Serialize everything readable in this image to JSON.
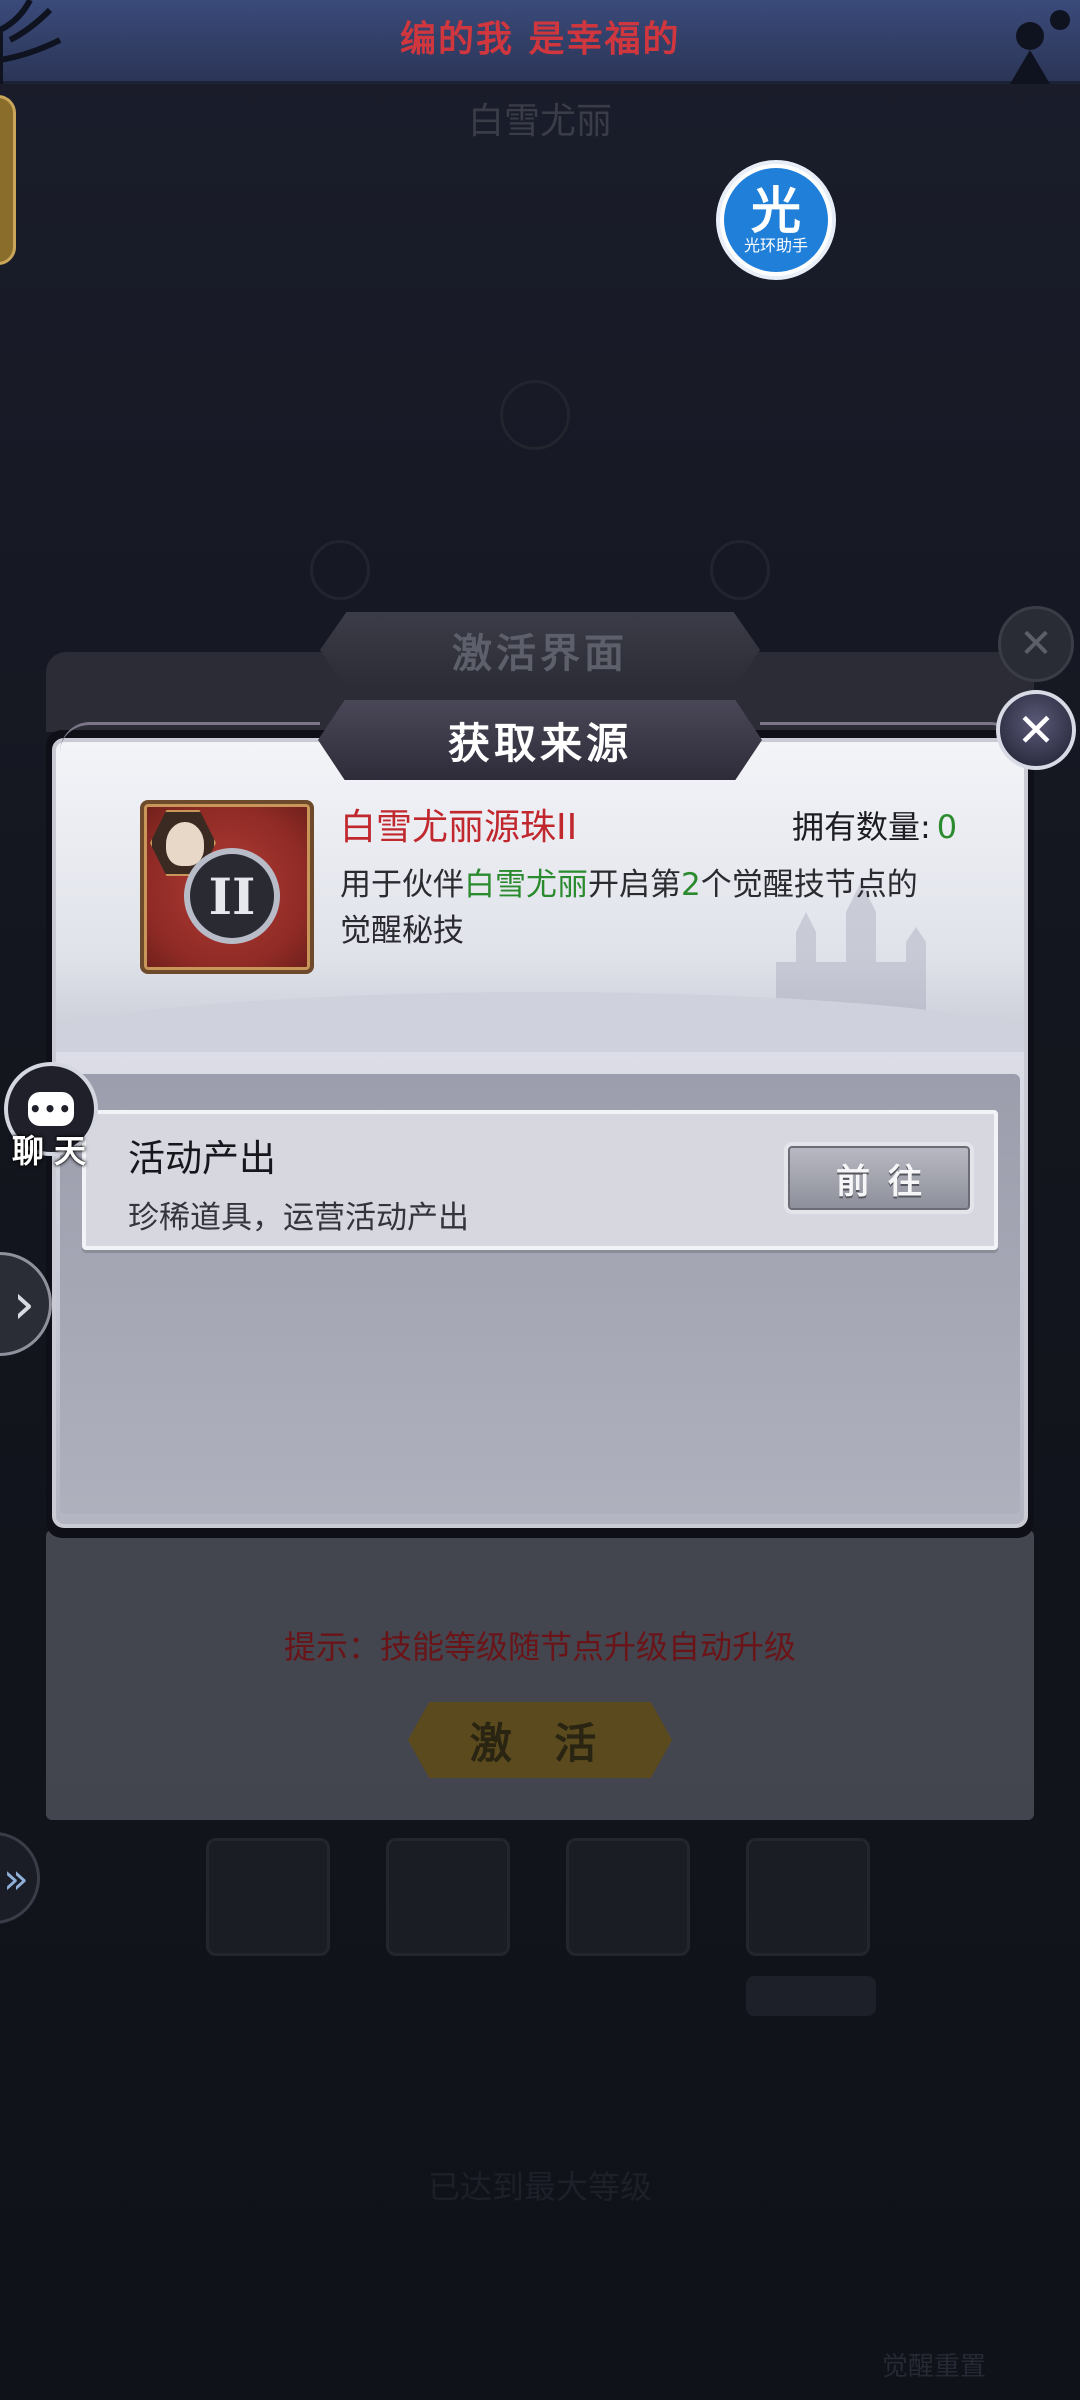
{
  "top_banner": {
    "marquee_text": "编的我 是幸福的"
  },
  "background": {
    "character_name": "白雪尤丽",
    "hint": "提示：技能等级随节点升级自动升级",
    "activate_label": "激 活",
    "max_level_text": "已达到最大等级",
    "reset_label": "觉醒重置"
  },
  "assistant_badge": {
    "glyph": "光",
    "caption": "光环助手"
  },
  "parent_dialog": {
    "title": "激活界面",
    "close_glyph": "✕"
  },
  "source_dialog": {
    "title": "获取来源",
    "close_glyph": "✕",
    "item": {
      "name": "白雪尤丽源珠II",
      "emblem_numeral": "II",
      "owned_label": "拥有数量:",
      "owned_count": "0",
      "desc_part1": "用于伙伴",
      "desc_highlight1": "白雪尤丽",
      "desc_part2": "开启第",
      "desc_highlight2": "2",
      "desc_part3": "个觉醒技节点的觉醒秘技"
    },
    "sources": [
      {
        "title": "活动产出",
        "desc": "珍稀道具，运营活动产出",
        "button": "前往"
      }
    ]
  },
  "overlay": {
    "chat_label": "聊天",
    "chat_dots": "•••",
    "side_arrow": "›",
    "side_arrow_2": "»"
  },
  "colors": {
    "item_name": "#c0282e",
    "highlight_green": "#2a8a2e",
    "dialog_bg": "#e7e9f1",
    "title_plate": "#2e2c39"
  }
}
